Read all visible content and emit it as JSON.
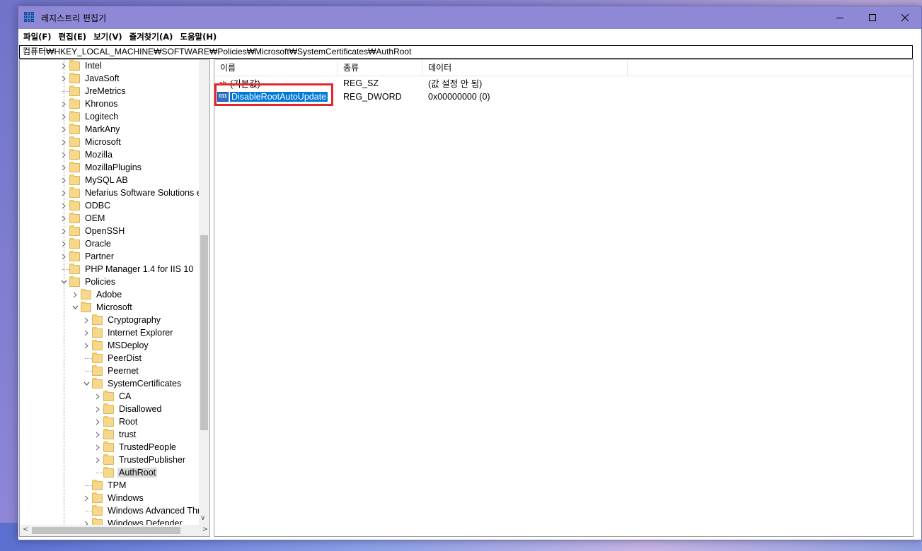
{
  "window": {
    "title": "레지스트리 편집기",
    "controls": [
      "minimize",
      "maximize",
      "close"
    ]
  },
  "menu": [
    "파일(F)",
    "편집(E)",
    "보기(V)",
    "즐겨찾기(A)",
    "도움말(H)"
  ],
  "address": "컴퓨터₩HKEY_LOCAL_MACHINE₩SOFTWARE₩Policies₩Microsoft₩SystemCertificates₩AuthRoot",
  "tree": [
    {
      "label": "Intel",
      "expander": ">"
    },
    {
      "label": "JavaSoft",
      "expander": ">"
    },
    {
      "label": "JreMetrics",
      "expander": ""
    },
    {
      "label": "Khronos",
      "expander": ">"
    },
    {
      "label": "Logitech",
      "expander": ">"
    },
    {
      "label": "MarkAny",
      "expander": ">"
    },
    {
      "label": "Microsoft",
      "expander": ">"
    },
    {
      "label": "Mozilla",
      "expander": ">"
    },
    {
      "label": "MozillaPlugins",
      "expander": ">"
    },
    {
      "label": "MySQL AB",
      "expander": ">"
    },
    {
      "label": "Nefarius Software Solutions e.",
      "expander": ">"
    },
    {
      "label": "ODBC",
      "expander": ">"
    },
    {
      "label": "OEM",
      "expander": ">"
    },
    {
      "label": "OpenSSH",
      "expander": ">"
    },
    {
      "label": "Oracle",
      "expander": ">"
    },
    {
      "label": "Partner",
      "expander": ">"
    },
    {
      "label": "PHP Manager 1.4 for IIS 10",
      "expander": ""
    },
    {
      "label": "Policies",
      "expander": "v"
    },
    {
      "label": "Adobe",
      "expander": ">"
    },
    {
      "label": "Microsoft",
      "expander": "v"
    },
    {
      "label": "Cryptography",
      "expander": ">"
    },
    {
      "label": "Internet Explorer",
      "expander": ">"
    },
    {
      "label": "MSDeploy",
      "expander": ">"
    },
    {
      "label": "PeerDist",
      "expander": ""
    },
    {
      "label": "Peernet",
      "expander": ""
    },
    {
      "label": "SystemCertificates",
      "expander": "v"
    },
    {
      "label": "CA",
      "expander": ">"
    },
    {
      "label": "Disallowed",
      "expander": ">"
    },
    {
      "label": "Root",
      "expander": ">"
    },
    {
      "label": "trust",
      "expander": ">"
    },
    {
      "label": "TrustedPeople",
      "expander": ">"
    },
    {
      "label": "TrustedPublisher",
      "expander": ">"
    },
    {
      "label": "AuthRoot",
      "expander": "",
      "selected": true
    },
    {
      "label": "TPM",
      "expander": ""
    },
    {
      "label": "Windows",
      "expander": ">"
    },
    {
      "label": "Windows Advanced Thre",
      "expander": ""
    },
    {
      "label": "Windows Defender",
      "expander": ">"
    }
  ],
  "list": {
    "headers": [
      "이름",
      "종류",
      "데이터"
    ],
    "rows": [
      {
        "icon": "ab",
        "name": "(기본값)",
        "type": "REG_SZ",
        "data": "(값 설정 안 됨)"
      },
      {
        "icon": "011",
        "name": "DisableRootAutoUpdate",
        "type": "REG_DWORD",
        "data": "0x00000000 (0)",
        "selected": true
      }
    ]
  },
  "colors": {
    "titlebar": "#8e88d7",
    "selection": "#0078d7",
    "highlight_box": "#e2262a"
  }
}
